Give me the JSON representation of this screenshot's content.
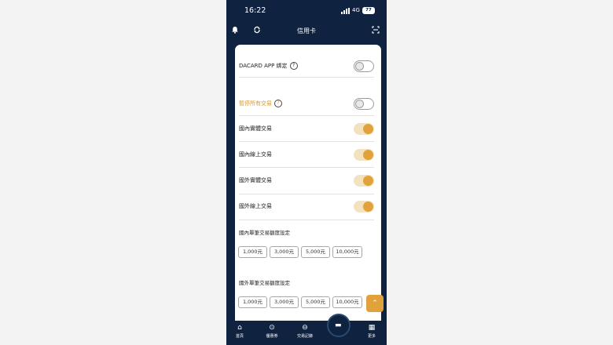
{
  "status": {
    "time": "16:22",
    "network": "4G",
    "battery": "77"
  },
  "header": {
    "title": "信用卡"
  },
  "icons": {
    "bell": "bell-icon",
    "refresh": "refresh-icon",
    "scan": "scan-icon"
  },
  "settings": {
    "dacard": {
      "label": "DACARD APP 綁定",
      "enabled": false
    },
    "pause_all": {
      "label": "暫停所有交易",
      "enabled": false,
      "color": "#d99a2b"
    },
    "domestic_physical": {
      "label": "國內實體交易",
      "enabled": true
    },
    "domestic_online": {
      "label": "國內線上交易",
      "enabled": true
    },
    "foreign_physical": {
      "label": "國外實體交易",
      "enabled": true
    },
    "foreign_online": {
      "label": "國外線上交易",
      "enabled": true
    }
  },
  "domestic_limit": {
    "title": "國內單筆交易額度設定",
    "options": [
      "1,000元",
      "3,000元",
      "5,000元",
      "10,000元"
    ]
  },
  "foreign_limit": {
    "title": "國外單筆交易額度設定",
    "options": [
      "1,000元",
      "3,000元",
      "5,000元",
      "10,000元"
    ]
  },
  "tabbar": {
    "home": "首頁",
    "coupon": "優惠券",
    "records": "交易記錄",
    "more": "更多"
  },
  "colors": {
    "navy": "#0f2240",
    "accent": "#e2a23b"
  }
}
